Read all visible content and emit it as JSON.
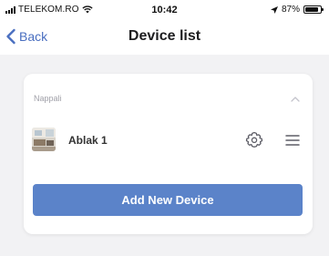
{
  "status_bar": {
    "carrier": "TELEKOM.RO",
    "time": "10:42",
    "battery": "87%",
    "battery_level": 0.87,
    "icons": [
      "signal-icon",
      "wifi-icon",
      "location-arrow-icon",
      "battery-icon"
    ]
  },
  "nav": {
    "back_label": "Back",
    "title": "Device list"
  },
  "group": {
    "label": "Nappali",
    "collapse_icon": "chevron-up-icon"
  },
  "devices": [
    {
      "name": "Ablak 1",
      "settings_icon": "gear-icon",
      "menu_icon": "hamburger-menu-icon"
    }
  ],
  "add_button_label": "Add New Device",
  "colors": {
    "accent": "#4a6fc0",
    "button": "#5b83c9",
    "background": "#f2f2f4",
    "card": "#ffffff"
  }
}
